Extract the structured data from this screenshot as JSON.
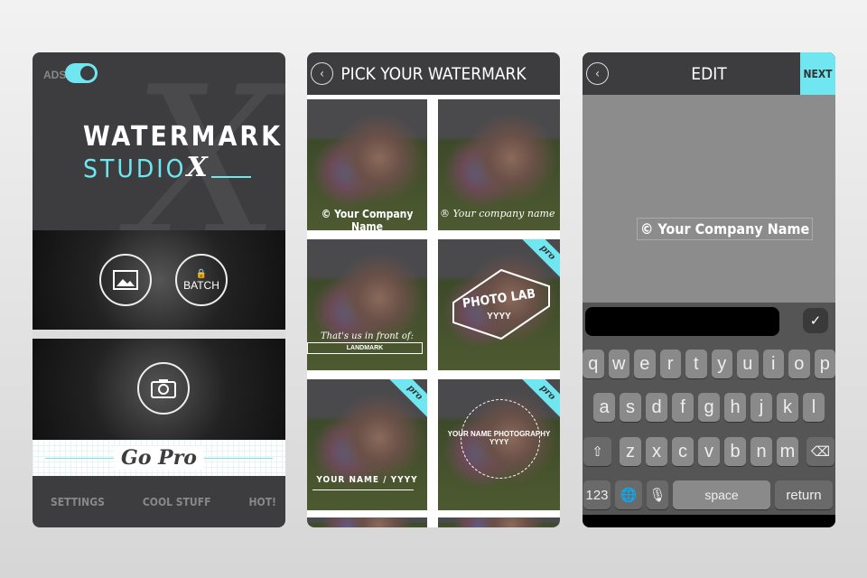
{
  "colors": {
    "accent": "#6fe6f0",
    "dark": "#3d3d3f"
  },
  "home": {
    "ads_label": "ADS",
    "ads_toggle_on": true,
    "title_line1": "WATERMARK",
    "title_line2": "STUDIO",
    "title_x": "X",
    "batch_label": "BATCH",
    "go_pro": "Go Pro",
    "nav": [
      "SETTINGS",
      "COOL STUFF",
      "HOT!"
    ]
  },
  "pick": {
    "title": "PICK YOUR WATERMARK",
    "tiles": [
      {
        "text": "© Your Company Name",
        "pro": false
      },
      {
        "text": "® Your company name",
        "pro": false
      },
      {
        "text": "That's us in front of:",
        "sub": "LANDMARK",
        "pro": false
      },
      {
        "text": "PHOTO LAB",
        "sub": "YYYY",
        "pro": true
      },
      {
        "text": "YOUR NAME / YYYY",
        "pro": true
      },
      {
        "text": "YOUR NAME PHOTOGRAPHY YYYY",
        "pro": true
      }
    ],
    "pro_label": "pro"
  },
  "edit": {
    "title": "EDIT",
    "next": "NEXT",
    "watermark": "© Your Company Name",
    "input_value": "",
    "keyboard": {
      "row1": [
        "q",
        "w",
        "e",
        "r",
        "t",
        "y",
        "u",
        "i",
        "o",
        "p"
      ],
      "row2": [
        "a",
        "s",
        "d",
        "f",
        "g",
        "h",
        "j",
        "k",
        "l"
      ],
      "row3": [
        "z",
        "x",
        "c",
        "v",
        "b",
        "n",
        "m"
      ],
      "numbers": "123",
      "space": "space",
      "return": "return"
    }
  }
}
